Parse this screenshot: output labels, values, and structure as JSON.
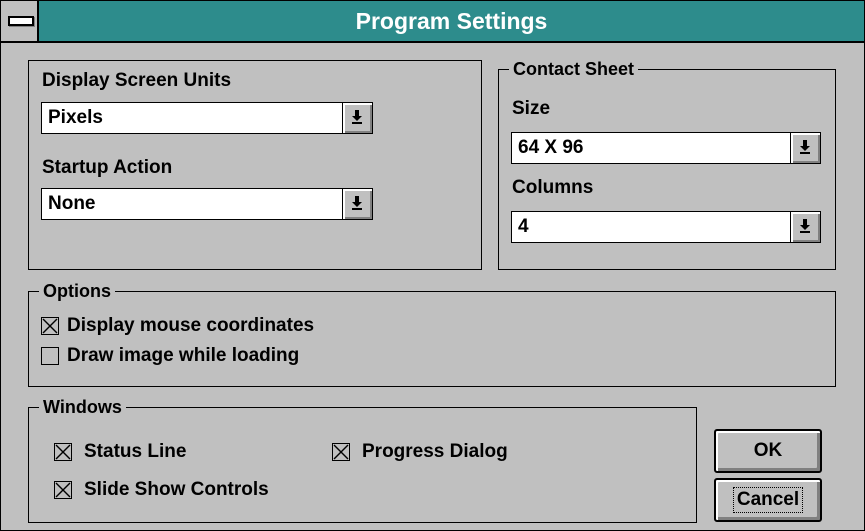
{
  "window": {
    "title": "Program Settings"
  },
  "display_screen_units": {
    "label": "Display Screen Units",
    "value": "Pixels"
  },
  "startup_action": {
    "label": "Startup Action",
    "value": "None"
  },
  "contact_sheet": {
    "title": "Contact Sheet",
    "size_label": "Size",
    "size_value": "64 X 96",
    "columns_label": "Columns",
    "columns_value": "4"
  },
  "options": {
    "title": "Options",
    "display_mouse_coordinates": {
      "label": "Display mouse coordinates",
      "checked": true
    },
    "draw_image_while_loading": {
      "label": "Draw image while loading",
      "checked": false
    }
  },
  "windows": {
    "title": "Windows",
    "status_line": {
      "label": "Status Line",
      "checked": true
    },
    "progress_dialog": {
      "label": "Progress Dialog",
      "checked": true
    },
    "slide_show_controls": {
      "label": "Slide Show Controls",
      "checked": true
    }
  },
  "buttons": {
    "ok": "OK",
    "cancel": "Cancel"
  },
  "icons": {
    "system_menu": "system-menu-icon",
    "dropdown": "dropdown-arrow-icon",
    "checkbox_mark": "x-mark"
  }
}
